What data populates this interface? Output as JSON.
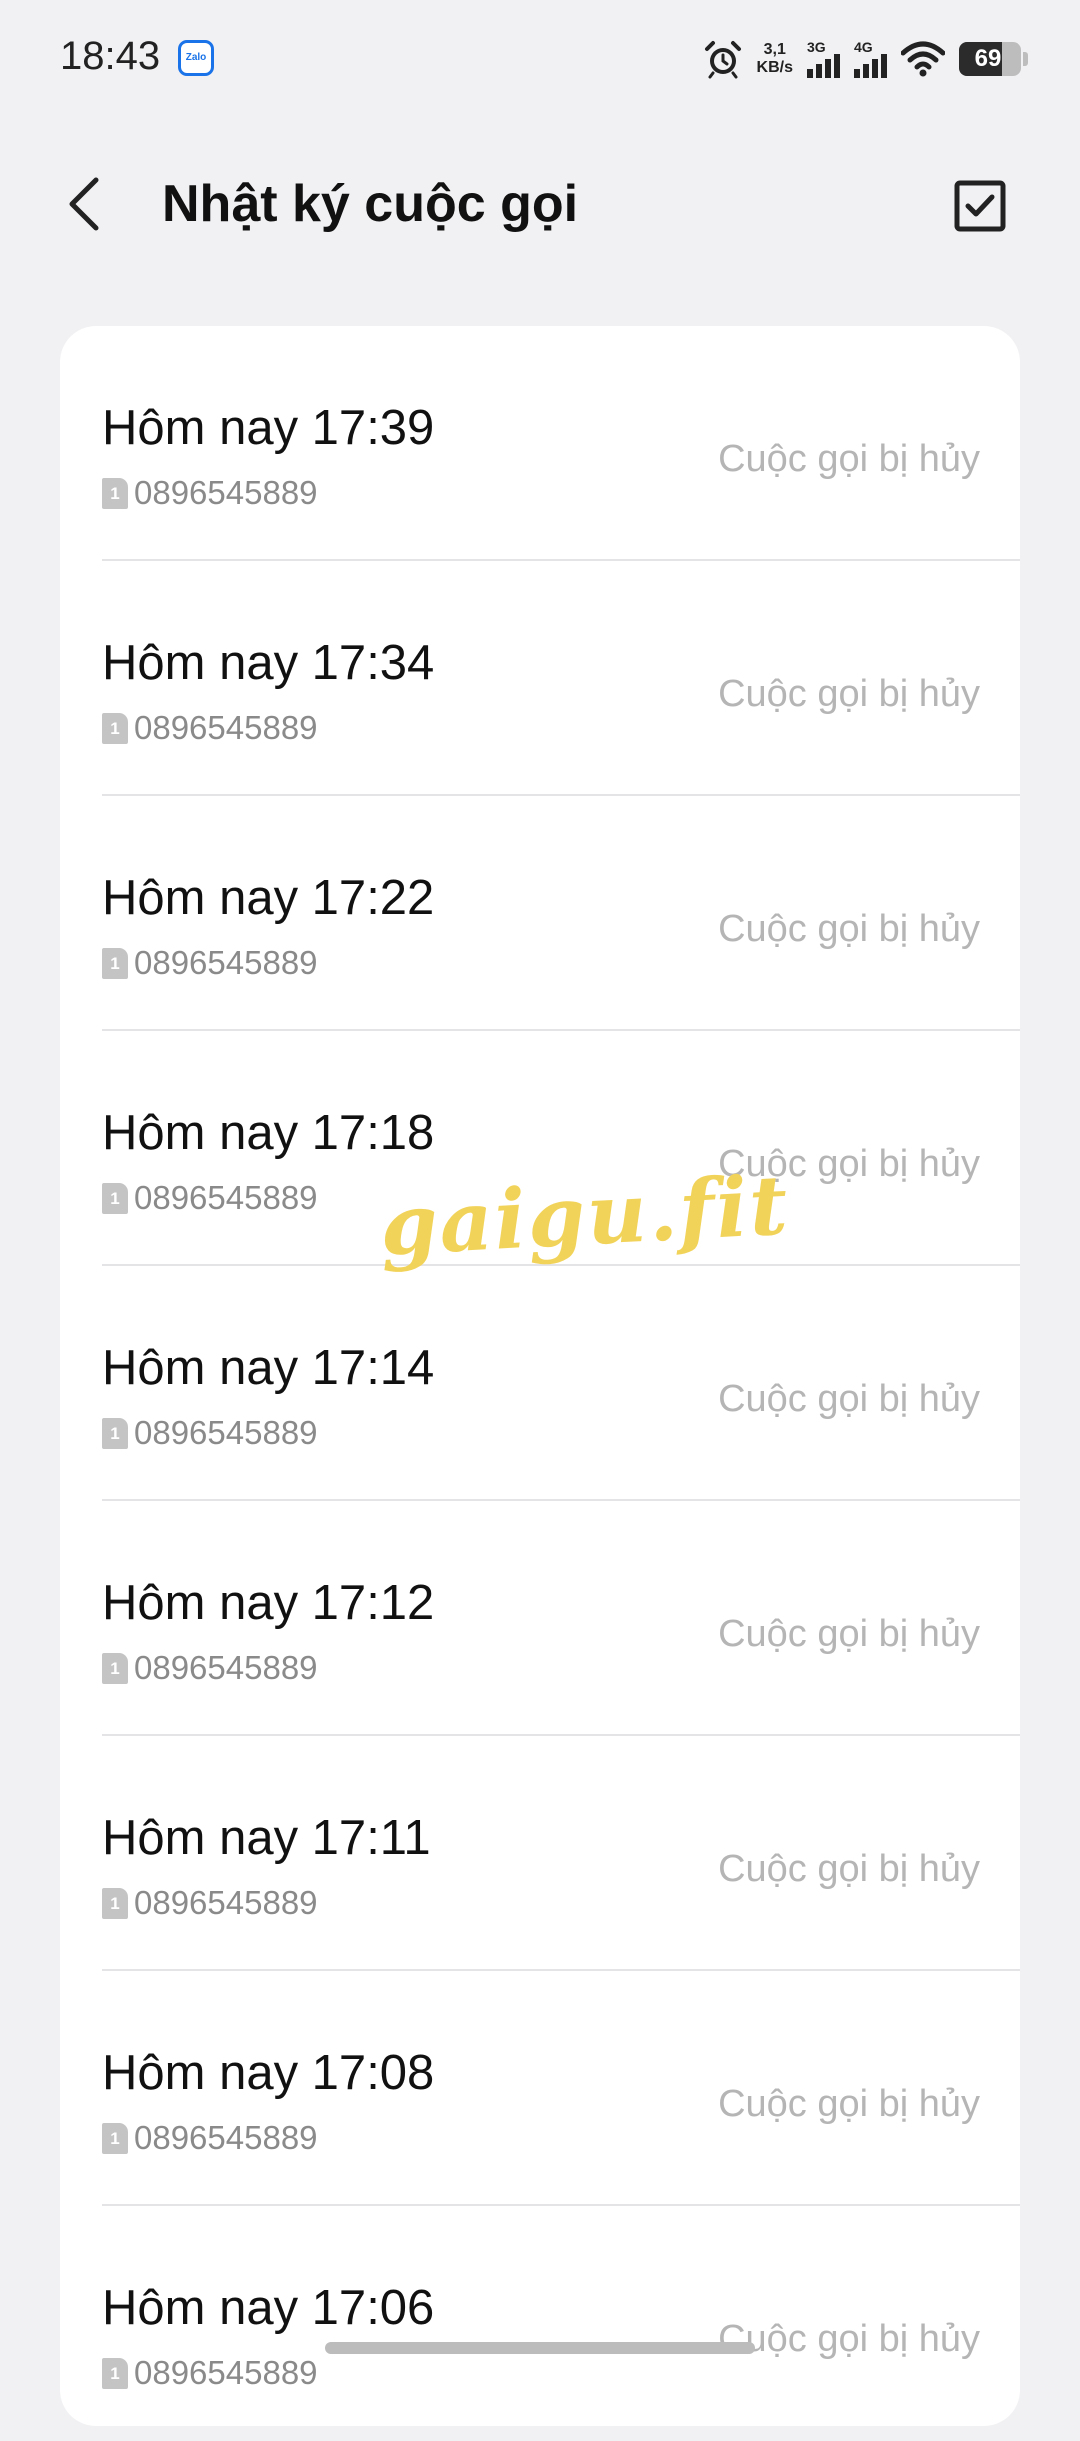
{
  "status_bar": {
    "time": "18:43",
    "notification_app": "Zalo",
    "net_speed_value": "3,1",
    "net_speed_unit": "KB/s",
    "signal_1_label": "3G",
    "signal_2_label": "4G",
    "battery_level": "69"
  },
  "header": {
    "title": "Nhật ký cuộc gọi",
    "back_icon": "chevron-left-icon",
    "select_icon": "checkbox-checked-icon"
  },
  "calls": [
    {
      "time": "Hôm nay 17:39",
      "sim": "1",
      "number": "0896545889",
      "status": "Cuộc gọi bị hủy"
    },
    {
      "time": "Hôm nay 17:34",
      "sim": "1",
      "number": "0896545889",
      "status": "Cuộc gọi bị hủy"
    },
    {
      "time": "Hôm nay 17:22",
      "sim": "1",
      "number": "0896545889",
      "status": "Cuộc gọi bị hủy"
    },
    {
      "time": "Hôm nay 17:18",
      "sim": "1",
      "number": "0896545889",
      "status": "Cuộc gọi bị hủy"
    },
    {
      "time": "Hôm nay 17:14",
      "sim": "1",
      "number": "0896545889",
      "status": "Cuộc gọi bị hủy"
    },
    {
      "time": "Hôm nay 17:12",
      "sim": "1",
      "number": "0896545889",
      "status": "Cuộc gọi bị hủy"
    },
    {
      "time": "Hôm nay 17:11",
      "sim": "1",
      "number": "0896545889",
      "status": "Cuộc gọi bị hủy"
    },
    {
      "time": "Hôm nay 17:08",
      "sim": "1",
      "number": "0896545889",
      "status": "Cuộc gọi bị hủy"
    },
    {
      "time": "Hôm nay 17:06",
      "sim": "1",
      "number": "0896545889",
      "status": "Cuộc gọi bị hủy"
    }
  ],
  "watermark": "gaigu.fit",
  "colors": {
    "background": "#f1f1f3",
    "card": "#ffffff",
    "status_text": "#b5b5b5",
    "watermark": "#f2d35a"
  }
}
